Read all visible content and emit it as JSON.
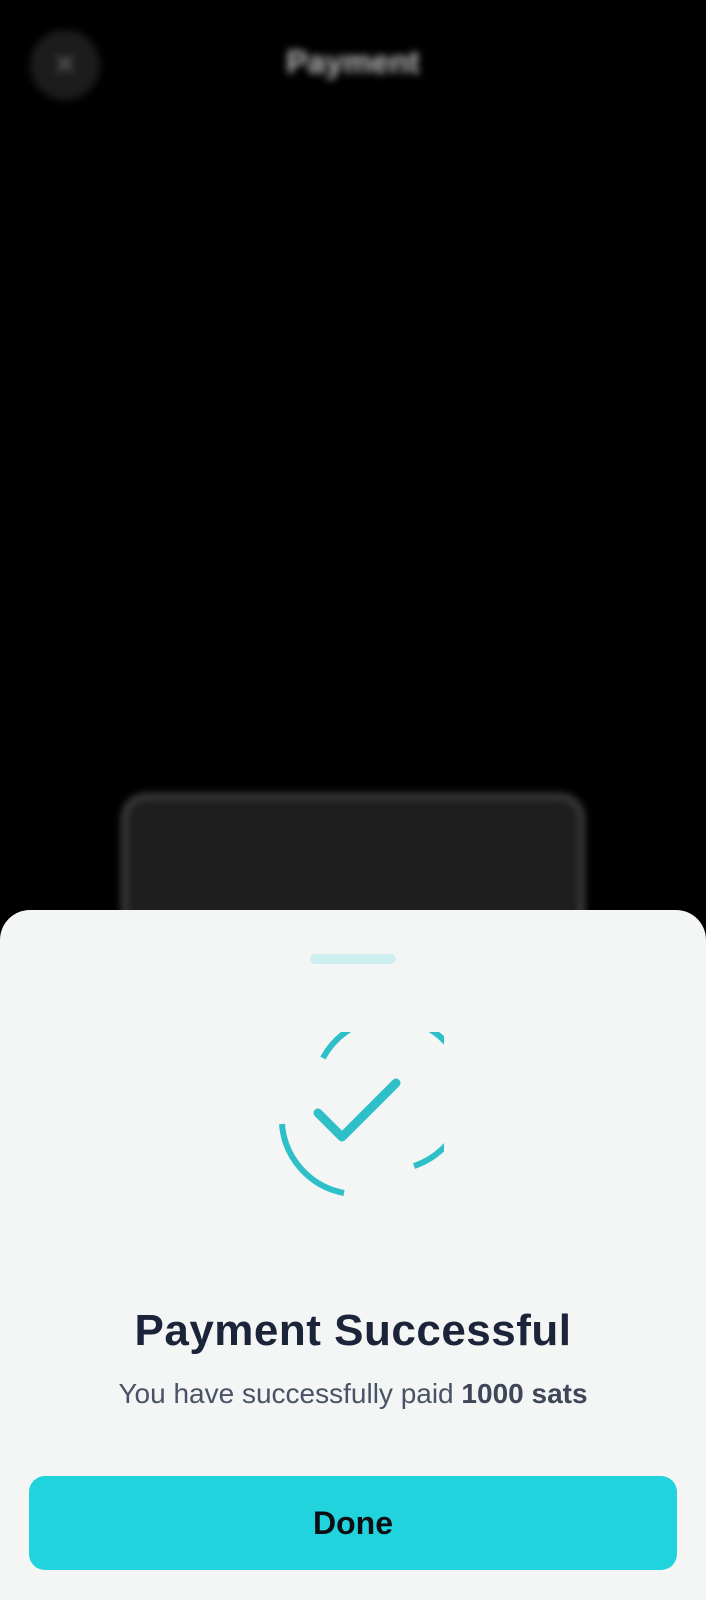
{
  "background": {
    "title": "Payment",
    "back_icon": "close-icon"
  },
  "sheet": {
    "icon": "check-circle-icon",
    "heading": "Payment Successful",
    "message_prefix": "You have successfully paid",
    "amount": "1000 sats",
    "done_label": "Done"
  },
  "colors": {
    "accent": "#20d3dc",
    "check": "#2ebfc8",
    "heading": "#1b2438",
    "sheet_bg": "#f4f6f6",
    "handle": "#cfeef0"
  }
}
